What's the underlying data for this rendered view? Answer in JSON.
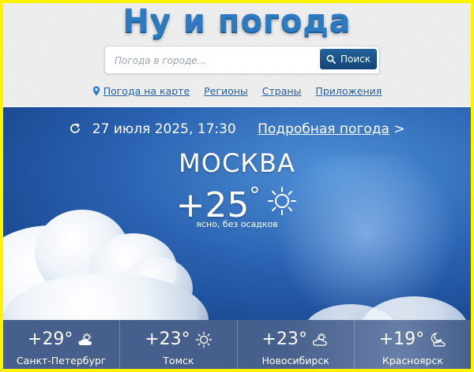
{
  "header": {
    "logo": "Ну и погода",
    "search": {
      "placeholder": "Погода в городе...",
      "value": "",
      "button_label": "Поиск"
    },
    "nav": [
      "Погода на карте",
      "Регионы",
      "Страны",
      "Приложения"
    ]
  },
  "current": {
    "datetime": "27 июля 2025, 17:30",
    "details_link": "Подробная погода",
    "details_arrow": ">",
    "city": "МОСКВА",
    "temperature": "+25",
    "degree": "°",
    "condition": "ясно, без осадков",
    "icon": "sun-icon"
  },
  "cities": [
    {
      "temperature": "+29",
      "degree": "°",
      "name": "Санкт-Петербург",
      "icon": "partly-cloudy-icon"
    },
    {
      "temperature": "+23",
      "degree": "°",
      "name": "Томск",
      "icon": "sun-icon"
    },
    {
      "temperature": "+23",
      "degree": "°",
      "name": "Новосибирск",
      "icon": "partly-cloudy-icon"
    },
    {
      "temperature": "+19",
      "degree": "°",
      "name": "Красноярск",
      "icon": "moon-cloud-icon"
    }
  ],
  "colors": {
    "frame": "#fff300",
    "logo": "#2e7ac2",
    "button": "#1a4f84",
    "link": "#1f5f9f",
    "sky": "#2a63b2"
  }
}
